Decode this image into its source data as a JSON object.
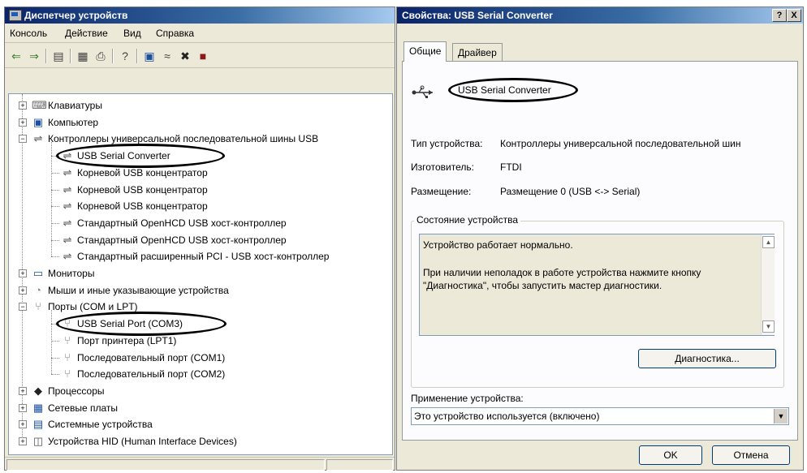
{
  "device_manager": {
    "title": "Диспетчер устройств",
    "menu": [
      "Консоль",
      "Действие",
      "Вид",
      "Справка"
    ],
    "toolbar_icons": [
      "back-icon",
      "forward-icon",
      "properties-icon",
      "view-icon",
      "print-icon",
      "help-icon",
      "scan-icon",
      "update-icon",
      "disable-icon",
      "uninstall-icon"
    ],
    "tree": [
      {
        "label": "Клавиатуры",
        "icon": "keyboard-icon",
        "expander": "+"
      },
      {
        "label": "Компьютер",
        "icon": "computer-icon",
        "expander": "+"
      },
      {
        "label": "Контроллеры универсальной последовательной шины USB",
        "icon": "usb-icon",
        "expander": "−"
      },
      {
        "label": "USB Serial Converter",
        "icon": "usb-icon"
      },
      {
        "label": "Корневой USB концентратор",
        "icon": "usb-icon"
      },
      {
        "label": "Корневой USB концентратор",
        "icon": "usb-icon"
      },
      {
        "label": "Корневой USB концентратор",
        "icon": "usb-icon"
      },
      {
        "label": "Стандартный OpenHCD USB хост-контроллер",
        "icon": "usb-icon"
      },
      {
        "label": "Стандартный OpenHCD USB хост-контроллер",
        "icon": "usb-icon"
      },
      {
        "label": "Стандартный расширенный PCI - USB хост-контроллер",
        "icon": "usb-icon"
      },
      {
        "label": "Мониторы",
        "icon": "monitor-icon",
        "expander": "+"
      },
      {
        "label": "Мыши и иные указывающие устройства",
        "icon": "mouse-icon",
        "expander": "+"
      },
      {
        "label": "Порты (COM и LPT)",
        "icon": "port-icon",
        "expander": "−"
      },
      {
        "label": "USB Serial Port (COM3)",
        "icon": "port-icon"
      },
      {
        "label": "Порт принтера (LPT1)",
        "icon": "port-icon"
      },
      {
        "label": "Последовательный порт (COM1)",
        "icon": "port-icon"
      },
      {
        "label": "Последовательный порт (COM2)",
        "icon": "port-icon"
      },
      {
        "label": "Процессоры",
        "icon": "cpu-icon",
        "expander": "+"
      },
      {
        "label": "Сетевые платы",
        "icon": "network-icon",
        "expander": "+"
      },
      {
        "label": "Системные устройства",
        "icon": "system-icon",
        "expander": "+"
      },
      {
        "label": "Устройства HID (Human Interface Devices)",
        "icon": "hid-icon",
        "expander": "+"
      }
    ]
  },
  "properties": {
    "title": "Свойства: USB Serial Converter",
    "title_buttons": [
      "?",
      "X"
    ],
    "tabs": [
      "Общие",
      "Драйвер"
    ],
    "device_name": "USB Serial Converter",
    "info": [
      {
        "label": "Тип устройства:",
        "value": "Контроллеры универсальной последовательной шин"
      },
      {
        "label": "Изготовитель:",
        "value": "FTDI"
      },
      {
        "label": "Размещение:",
        "value": "Размещение 0 (USB <-> Serial)"
      }
    ],
    "status_group_title": "Состояние устройства",
    "status_line1": "Устройство работает нормально.",
    "status_line2": "При наличии неполадок в работе устройства нажмите кнопку",
    "status_line3": "\"Диагностика\", чтобы запустить мастер диагностики.",
    "diagnostics_button": "Диагностика...",
    "usage_label": "Применение устройства:",
    "usage_value": "Это устройство используется (включено)",
    "ok_button": "OK",
    "cancel_button": "Отмена"
  }
}
